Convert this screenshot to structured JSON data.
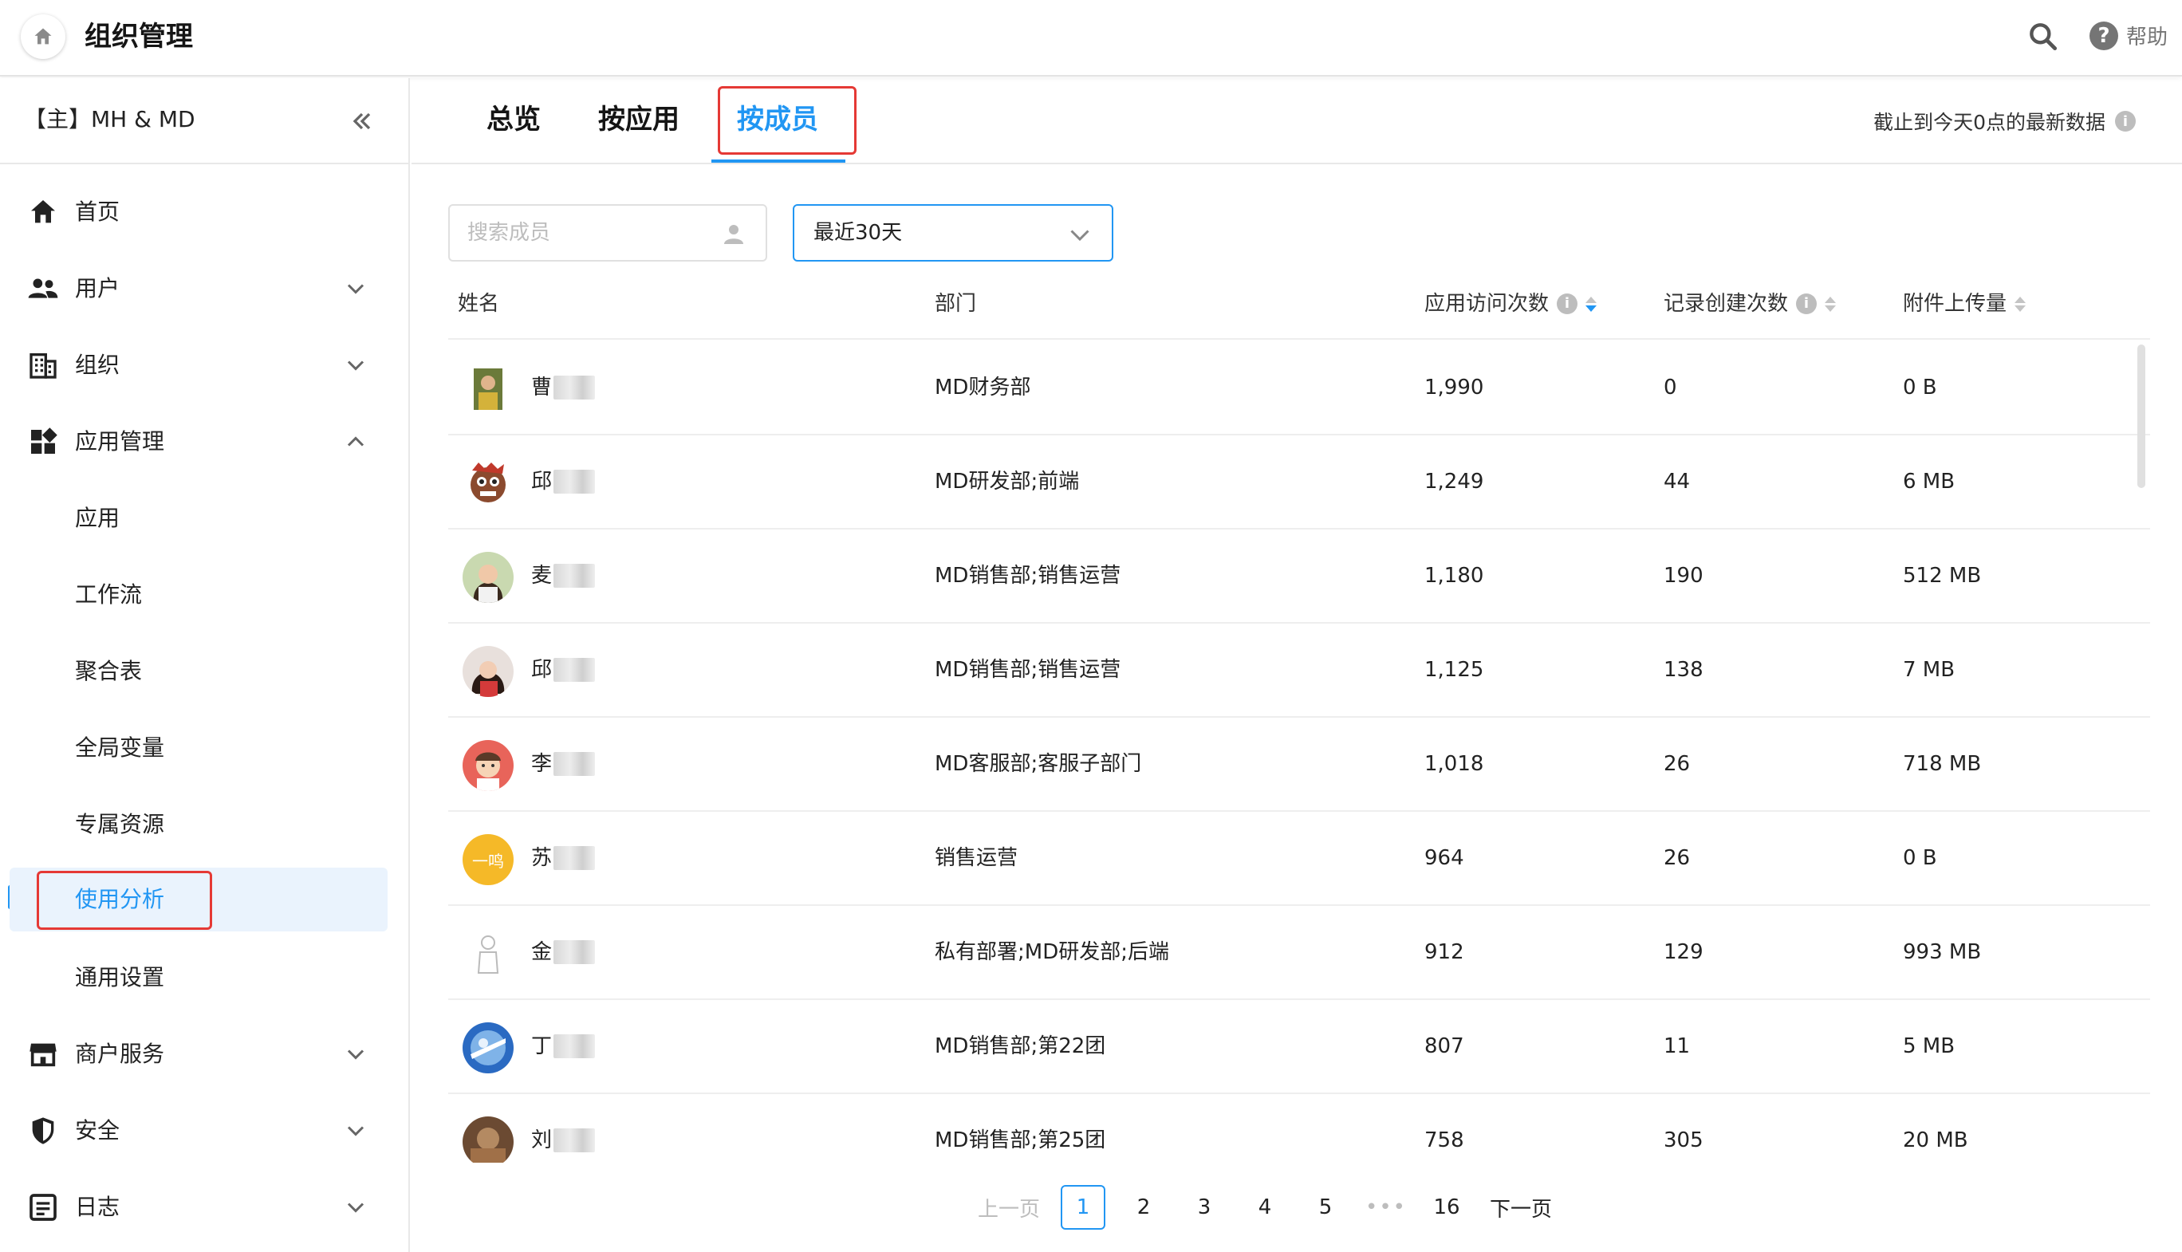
{
  "header": {
    "title": "组织管理",
    "help_label": "帮助",
    "icons": [
      "home-icon",
      "search-icon",
      "help-icon"
    ]
  },
  "sidebar": {
    "org_name": "【主】MH & MD",
    "items": [
      {
        "label": "首页",
        "icon": "home-icon"
      },
      {
        "label": "用户",
        "icon": "users-icon",
        "expanded": false
      },
      {
        "label": "组织",
        "icon": "building-icon",
        "expanded": false
      },
      {
        "label": "应用管理",
        "icon": "apps-icon",
        "expanded": true
      },
      {
        "label": "应用"
      },
      {
        "label": "工作流"
      },
      {
        "label": "聚合表"
      },
      {
        "label": "全局变量"
      },
      {
        "label": "专属资源"
      },
      {
        "label": "使用分析",
        "active": true
      },
      {
        "label": "通用设置"
      },
      {
        "label": "商户服务",
        "icon": "store-icon",
        "expanded": false
      },
      {
        "label": "安全",
        "icon": "shield-icon",
        "expanded": false
      },
      {
        "label": "日志",
        "icon": "log-icon",
        "expanded": false
      }
    ]
  },
  "tabs": [
    {
      "label": "总览"
    },
    {
      "label": "按应用"
    },
    {
      "label": "按成员",
      "active": true
    }
  ],
  "data_note": "截止到今天0点的最新数据",
  "filters": {
    "search_placeholder": "搜索成员",
    "date_range": "最近30天"
  },
  "table": {
    "columns": [
      "姓名",
      "部门",
      "应用访问次数",
      "记录创建次数",
      "附件上传量"
    ],
    "sorted_column": "应用访问次数",
    "rows": [
      {
        "name": "曹",
        "dept": "MD财务部",
        "visits": "1,990",
        "records": "0",
        "uploads": "0 B"
      },
      {
        "name": "邱",
        "dept": "MD研发部;前端",
        "visits": "1,249",
        "records": "44",
        "uploads": "6 MB"
      },
      {
        "name": "麦",
        "dept": "MD销售部;销售运营",
        "visits": "1,180",
        "records": "190",
        "uploads": "512 MB"
      },
      {
        "name": "邱",
        "dept": "MD销售部;销售运营",
        "visits": "1,125",
        "records": "138",
        "uploads": "7 MB"
      },
      {
        "name": "李",
        "dept": "MD客服部;客服子部门",
        "visits": "1,018",
        "records": "26",
        "uploads": "718 MB"
      },
      {
        "name": "苏",
        "dept": "销售运营",
        "visits": "964",
        "records": "26",
        "uploads": "0 B",
        "avatar_text": "一鸣"
      },
      {
        "name": "金",
        "dept": "私有部署;MD研发部;后端",
        "visits": "912",
        "records": "129",
        "uploads": "993 MB"
      },
      {
        "name": "丁",
        "dept": "MD销售部;第22团",
        "visits": "807",
        "records": "11",
        "uploads": "5 MB"
      },
      {
        "name": "刘",
        "dept": "MD销售部;第25团",
        "visits": "758",
        "records": "305",
        "uploads": "20 MB"
      }
    ]
  },
  "pagination": {
    "prev": "上一页",
    "pages": [
      "1",
      "2",
      "3",
      "4",
      "5"
    ],
    "ellipsis": "•••",
    "last": "16",
    "next": "下一页",
    "current": "1"
  },
  "colors": {
    "accent": "#2196f3",
    "highlight_box": "#e53935",
    "active_bg": "#eaf3fd"
  }
}
